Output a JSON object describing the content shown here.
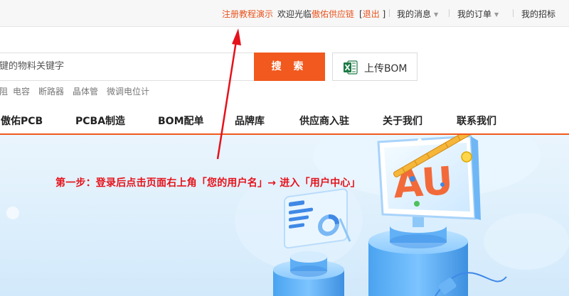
{
  "topbar": {
    "tutorial": "注册教程演示",
    "welcome_prefix": "欢迎光临",
    "username": "傲佑供应链",
    "logout_open": "[",
    "logout": "退出",
    "logout_close": "]",
    "menus": [
      {
        "label": "我的消息"
      },
      {
        "label": "我的订单"
      },
      {
        "label": "我的招标"
      }
    ]
  },
  "search": {
    "placeholder": "键的物料关键字",
    "button": "搜 索",
    "bom_button": "上传BOM"
  },
  "hot_keywords": [
    "阻",
    "电容",
    "断路器",
    "晶体管",
    "微调电位计"
  ],
  "nav": [
    "傲佑PCB",
    "PCBA制造",
    "BOM配单",
    "品牌库",
    "供应商入驻",
    "关于我们",
    "联系我们"
  ],
  "annotation": {
    "text": "第一步：登录后点击页面右上角「您的用户名」→ 进入「用户中心」"
  },
  "colors": {
    "accent": "#f1591e",
    "annotation": "#e5121b",
    "banner": "#dff0fc"
  }
}
